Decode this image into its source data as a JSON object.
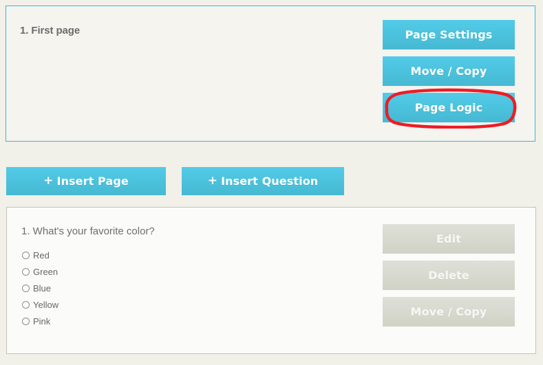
{
  "theme": {
    "page_background": "#f1f0e9",
    "panel_background": "#f5f4ef",
    "question_panel_background": "#fbfbfa",
    "accent_cyan": "#4cc3de",
    "page_panel_border": "#35b9e0",
    "question_panel_border": "#c3c3b4",
    "grey_button": "#d8d9cf",
    "highlight_red": "#ee1c25",
    "text_grey": "#6b6b6b"
  },
  "page_panel": {
    "title": "1. First page",
    "buttons": [
      {
        "label": "Page Settings",
        "name": "page-settings-button"
      },
      {
        "label": "Move / Copy",
        "name": "page-move-copy-button"
      },
      {
        "label": "Page Logic",
        "name": "page-logic-button",
        "highlighted": true
      }
    ]
  },
  "insert_bar": {
    "plus": "+",
    "buttons": [
      {
        "label": "Insert Page",
        "name": "insert-page-button"
      },
      {
        "label": "Insert Question",
        "name": "insert-question-button"
      }
    ]
  },
  "question_panel": {
    "title": "1. What's your favorite color?",
    "options": [
      {
        "label": "Red",
        "selected": false
      },
      {
        "label": "Green",
        "selected": false
      },
      {
        "label": "Blue",
        "selected": false
      },
      {
        "label": "Yellow",
        "selected": false
      },
      {
        "label": "Pink",
        "selected": false
      }
    ],
    "buttons": [
      {
        "label": "Edit",
        "name": "edit-button"
      },
      {
        "label": "Delete",
        "name": "delete-button"
      },
      {
        "label": "Move / Copy",
        "name": "question-move-copy-button"
      }
    ]
  },
  "annotation": {
    "type": "hand-drawn-oval",
    "color": "#ee1c25",
    "targets": "Page Logic"
  }
}
